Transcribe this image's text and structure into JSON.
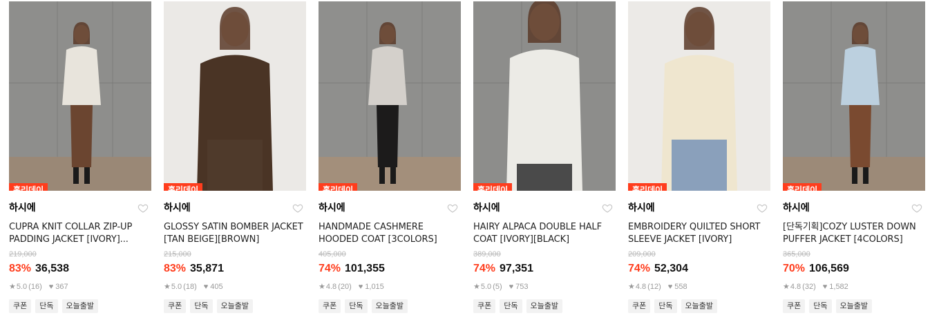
{
  "products": [
    {
      "badge": "홀리데이",
      "brand": "하시에",
      "name": "CUPRA KNIT COLLAR ZIP-UP PADDING JACKET [IVORY]...",
      "original_price": "219,000",
      "discount": "83%",
      "price": "36,538",
      "rating": "5.0",
      "review_count": "(16)",
      "likes": "367",
      "tags": [
        "쿠폰",
        "단독",
        "오늘출발"
      ],
      "colors": {
        "bg": "#8e8e8c",
        "coat": "#e8e4dc",
        "skirt": "#6b4530",
        "floor": "#9a8876"
      }
    },
    {
      "badge": "홀리데이",
      "brand": "하시에",
      "name": "GLOSSY SATIN BOMBER JACKET [TAN BEIGE][BROWN]",
      "original_price": "215,000",
      "discount": "83%",
      "price": "35,871",
      "rating": "5.0",
      "review_count": "(18)",
      "likes": "405",
      "tags": [
        "쿠폰",
        "단독",
        "오늘출발"
      ],
      "colors": {
        "bg": "#ebe9e6",
        "coat": "#4a3425",
        "skirt": "#4f3a2b",
        "floor": "#ebe9e6"
      }
    },
    {
      "badge": "홀리데이",
      "brand": "하시에",
      "name": "HANDMADE CASHMERE HOODED COAT [3COLORS]",
      "original_price": "405,000",
      "discount": "74%",
      "price": "101,355",
      "rating": "4.8",
      "review_count": "(20)",
      "likes": "1,015",
      "tags": [
        "쿠폰",
        "단독",
        "오늘출발"
      ],
      "colors": {
        "bg": "#8f8f8d",
        "coat": "#d4d0cb",
        "skirt": "#1c1b1b",
        "floor": "#a38f7b"
      }
    },
    {
      "badge": "홀리데이",
      "brand": "하시에",
      "name": "HAIRY ALPACA DOUBLE HALF COAT [IVORY][BLACK]",
      "original_price": "389,000",
      "discount": "74%",
      "price": "97,351",
      "rating": "5.0",
      "review_count": "(5)",
      "likes": "753",
      "tags": [
        "쿠폰",
        "단독",
        "오늘출발"
      ],
      "colors": {
        "bg": "#8d8d8b",
        "coat": "#ecebe6",
        "skirt": "#4a4a4a",
        "floor": "#8d8d8b"
      }
    },
    {
      "badge": "홀리데이",
      "brand": "하시에",
      "name": "EMBROIDERY QUILTED SHORT SLEEVE JACKET [IVORY]",
      "original_price": "209,000",
      "discount": "74%",
      "price": "52,304",
      "rating": "4.8",
      "review_count": "(12)",
      "likes": "558",
      "tags": [
        "쿠폰",
        "단독",
        "오늘출발"
      ],
      "colors": {
        "bg": "#eceae7",
        "coat": "#efe6cf",
        "skirt": "#8aa0bb",
        "floor": "#eceae7"
      }
    },
    {
      "badge": "홀리데이",
      "brand": "하시에",
      "name": "[단독기획]COZY LUSTER DOWN PUFFER JACKET [4COLORS]",
      "original_price": "365,000",
      "discount": "70%",
      "price": "106,569",
      "rating": "4.8",
      "review_count": "(32)",
      "likes": "1,582",
      "tags": [
        "쿠폰",
        "단독",
        "오늘출발"
      ],
      "colors": {
        "bg": "#8e8e8c",
        "coat": "#bcd0df",
        "skirt": "#7a4a30",
        "floor": "#9c8a78"
      }
    }
  ],
  "accent_color": "#ff3d1d"
}
